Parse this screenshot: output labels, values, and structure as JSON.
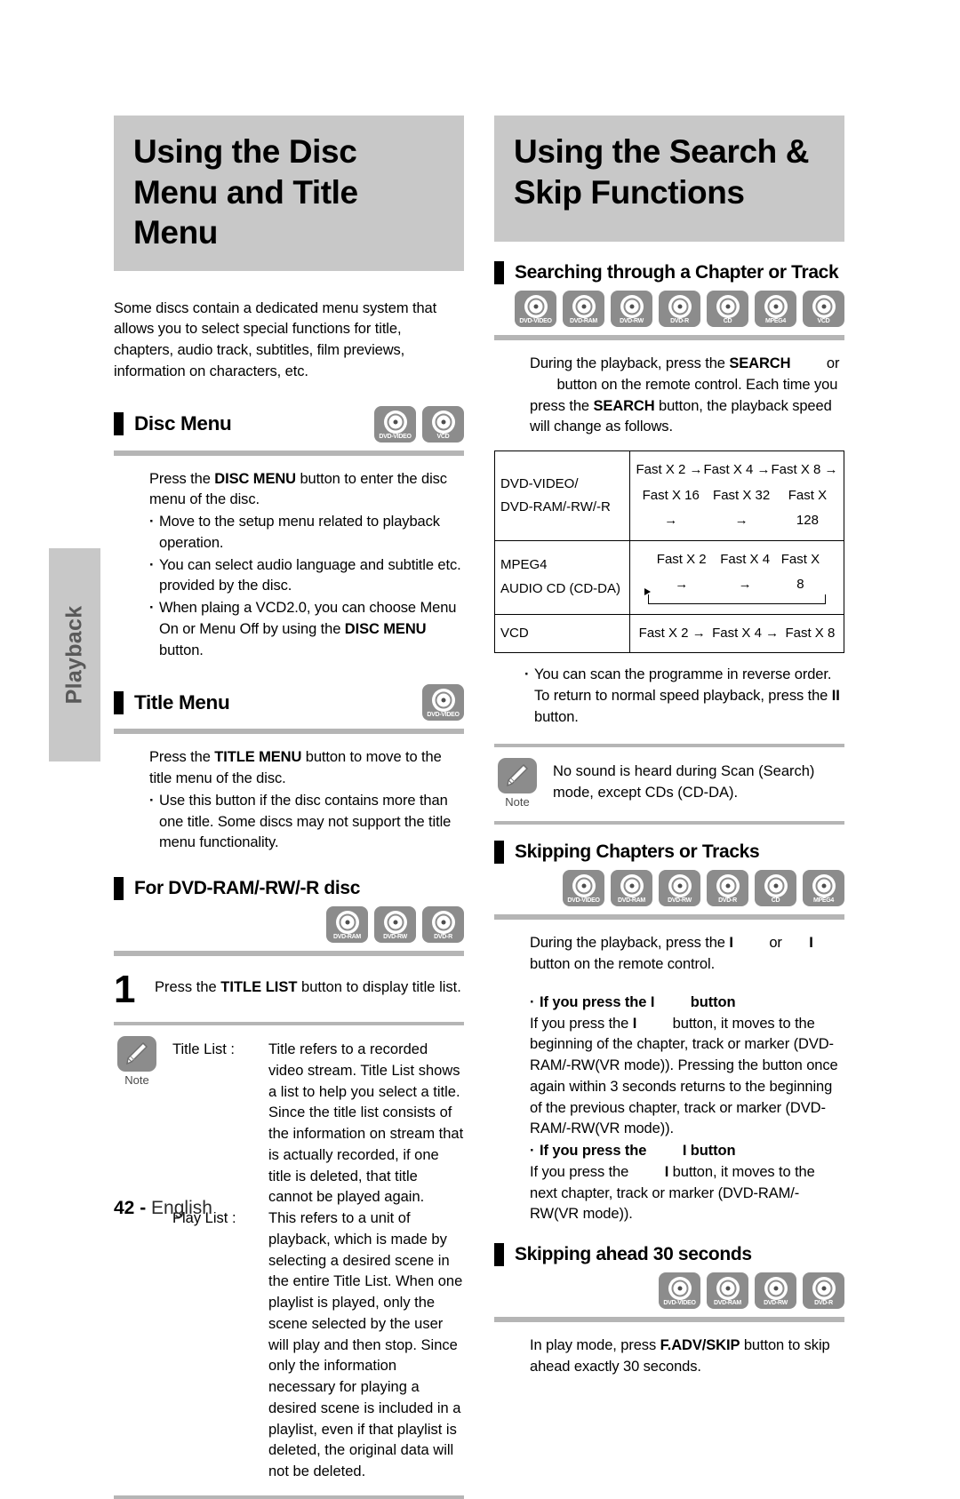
{
  "side_tab": {
    "label": "Playback"
  },
  "footer": {
    "page_number": "42",
    "separator": "-",
    "language": "English"
  },
  "left_column": {
    "banner_title": "Using the Disc Menu and Title Menu",
    "intro": "Some discs contain a dedicated menu system that allows you to select special functions for title, chapters, audio track, subtitles, film previews, information on characters, etc.",
    "disc_menu": {
      "heading": "Disc Menu",
      "icons": [
        "DVD-VIDEO",
        "VCD"
      ],
      "intro": "Press the DISC MENU button to enter the disc menu of the disc.",
      "intro_parts": {
        "a": "Press the ",
        "bold": "DISC MENU",
        "b": " button to enter the disc menu of the disc."
      },
      "bullets": [
        "Move to the setup menu related to playback operation.",
        "You can select audio language and subtitle etc. provided by the disc.",
        "When plaing a VCD2.0, you can choose Menu On or Menu Off by using the DISC MENU button."
      ],
      "bullet3_parts": {
        "a": "When plaing a VCD2.0, you can choose Menu On or Menu Off by using the ",
        "bold": "DISC MENU",
        "b": " button."
      }
    },
    "title_menu": {
      "heading": "Title Menu",
      "icons": [
        "DVD-VIDEO"
      ],
      "intro_parts": {
        "a": "Press the ",
        "bold": "TITLE MENU",
        "b": " button to move to the title menu of the disc."
      },
      "bullets": [
        "Use this button if the disc contains more than one title. Some discs may not support the title menu functionality."
      ]
    },
    "dvd_ram_section": {
      "heading": "For DVD-RAM/-RW/-R disc",
      "icons": [
        "DVD-RAM",
        "DVD-RW",
        "DVD-R"
      ],
      "step_number": "1",
      "step_parts": {
        "a": "Press the ",
        "bold": "TITLE LIST",
        "b": " button to display title list."
      },
      "note": {
        "caption": "Note",
        "terms": [
          {
            "term": "Title List :",
            "desc": "Title refers to a recorded video stream. Title List shows a list to help you select a title. Since the title list consists of the information on stream that is actually recorded, if one title is deleted, that title cannot be played again."
          },
          {
            "term": "Play List :",
            "desc": "This refers to a unit of playback, which is made by selecting a desired scene in the entire Title List. When one playlist is played, only the scene selected by the user will play and then stop. Since only the information necessary for playing a desired scene is included in a playlist, even if that playlist is deleted, the original data will not be deleted."
          }
        ]
      }
    }
  },
  "right_column": {
    "banner_title": "Using the Search & Skip Functions",
    "searching": {
      "heading": "Searching through a Chapter or Track",
      "icons": [
        "DVD-VIDEO",
        "DVD-RAM",
        "DVD-RW",
        "DVD-R",
        "CD",
        "MPEG4",
        "VCD"
      ],
      "intro_parts": {
        "a": "During the playback, press the ",
        "bold1": "SEARCH",
        "b": " or ",
        "c": " button on the remote control. Each time you press the ",
        "bold2": "SEARCH",
        "d": " button, the playback speed will change as follows."
      },
      "table": {
        "rows": [
          {
            "format": [
              "DVD-VIDEO/",
              "DVD-RAM/-RW/-R"
            ],
            "speeds_line1": [
              "Fast X 2 →",
              "Fast X 4 →",
              "Fast X 8 →"
            ],
            "speeds_line2": [
              "Fast X 16 →",
              "Fast X 32 →",
              "Fast X 128"
            ],
            "loop": false
          },
          {
            "format": [
              "MPEG4",
              "AUDIO CD (CD-DA)"
            ],
            "speeds_line1": [
              "Fast X 2 →",
              "Fast X 4 →",
              "Fast X 8"
            ],
            "speeds_line2": [],
            "loop": true
          },
          {
            "format": [
              "VCD"
            ],
            "speeds_line1": [
              "Fast X 2 →",
              "Fast X 4 →",
              "Fast X 8"
            ],
            "speeds_line2": [],
            "loop": false
          }
        ]
      },
      "bullets_parts": {
        "a": "You can scan the programme in reverse order. To return to normal speed playback, press the ",
        "glyph": "II",
        "b": " button."
      },
      "note": {
        "caption": "Note",
        "text": "No sound is heard during Scan (Search) mode, except CDs (CD-DA)."
      }
    },
    "skipping": {
      "heading": "Skipping Chapters or Tracks",
      "icons": [
        "DVD-VIDEO",
        "DVD-RAM",
        "DVD-RW",
        "DVD-R",
        "CD",
        "MPEG4"
      ],
      "intro_parts": {
        "a": "During the playback, press the ",
        "glyph1": "I",
        "b": " or ",
        "glyph2": "I",
        "c": " button on the remote control."
      },
      "prev": {
        "heading_parts": {
          "a": "If you press the ",
          "glyph": "I",
          "b": " button"
        },
        "body_parts": {
          "a": "If you press the ",
          "glyph": "I",
          "b": " button, it moves to the beginning of the chapter, track or marker (DVD-RAM/-RW(VR mode)). Pressing the button once again within 3 seconds returns to the beginning of the previous chapter, track or marker (DVD-RAM/-RW(VR mode))."
        }
      },
      "next": {
        "heading_parts": {
          "a": "If you press the ",
          "glyph": "I",
          "b": " button"
        },
        "body_parts": {
          "a": "If you press the ",
          "glyph": "I",
          "b": " button, it moves to the next chapter, track or marker (DVD-RAM/-RW(VR mode))."
        }
      }
    },
    "skip_ahead": {
      "heading": "Skipping ahead 30 seconds",
      "icons": [
        "DVD-VIDEO",
        "DVD-RAM",
        "DVD-RW",
        "DVD-R"
      ],
      "body_parts": {
        "a": "In play mode, press ",
        "bold": "F.ADV/SKIP",
        "b": " button to skip ahead exactly 30 seconds."
      }
    }
  }
}
